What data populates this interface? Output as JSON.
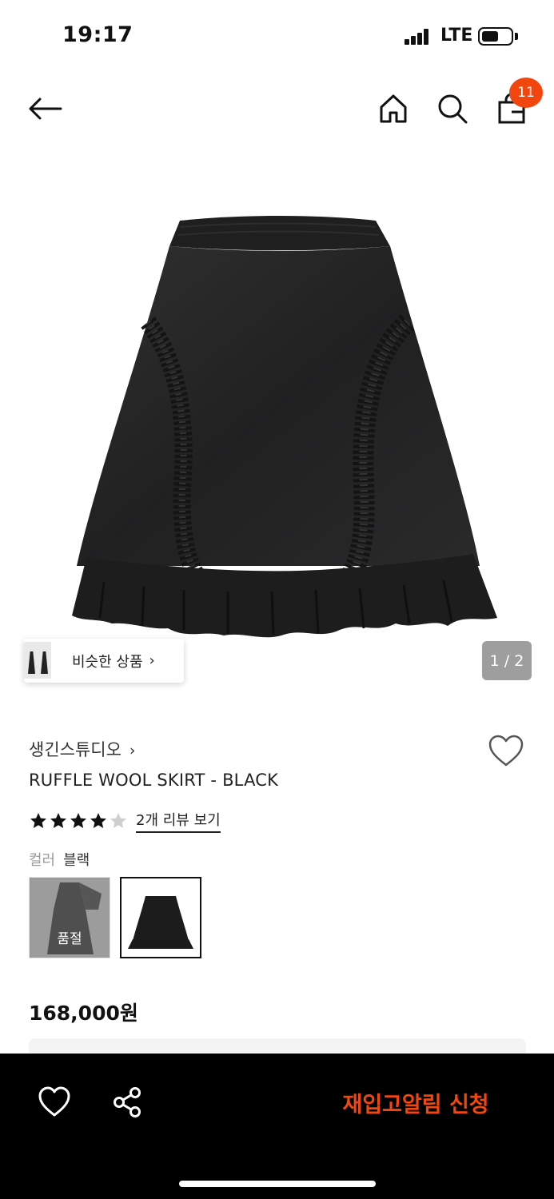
{
  "status_bar": {
    "time": "19:17",
    "network": "LTE",
    "battery_level": 0.55
  },
  "header": {
    "cart_count": "11",
    "icons": [
      "back-arrow-icon",
      "home-icon",
      "search-icon",
      "shopping-bag-icon"
    ]
  },
  "gallery": {
    "similar_label": "비슷한 상품",
    "page_indicator": "1 / 2"
  },
  "product": {
    "brand": "생긴스튜디오",
    "name": "RUFFLE WOOL SKIRT - BLACK",
    "rating": 4,
    "rating_max": 5,
    "review_link": "2개 리뷰 보기",
    "color_label": "컬러",
    "color_value": "블랙",
    "swatches": [
      {
        "state": "soldout",
        "label": "품절"
      },
      {
        "state": "selected",
        "label": ""
      }
    ],
    "price": "168,000원"
  },
  "bottom_bar": {
    "restock_label": "재입고알림 신청",
    "accent_color": "#f2460f"
  }
}
